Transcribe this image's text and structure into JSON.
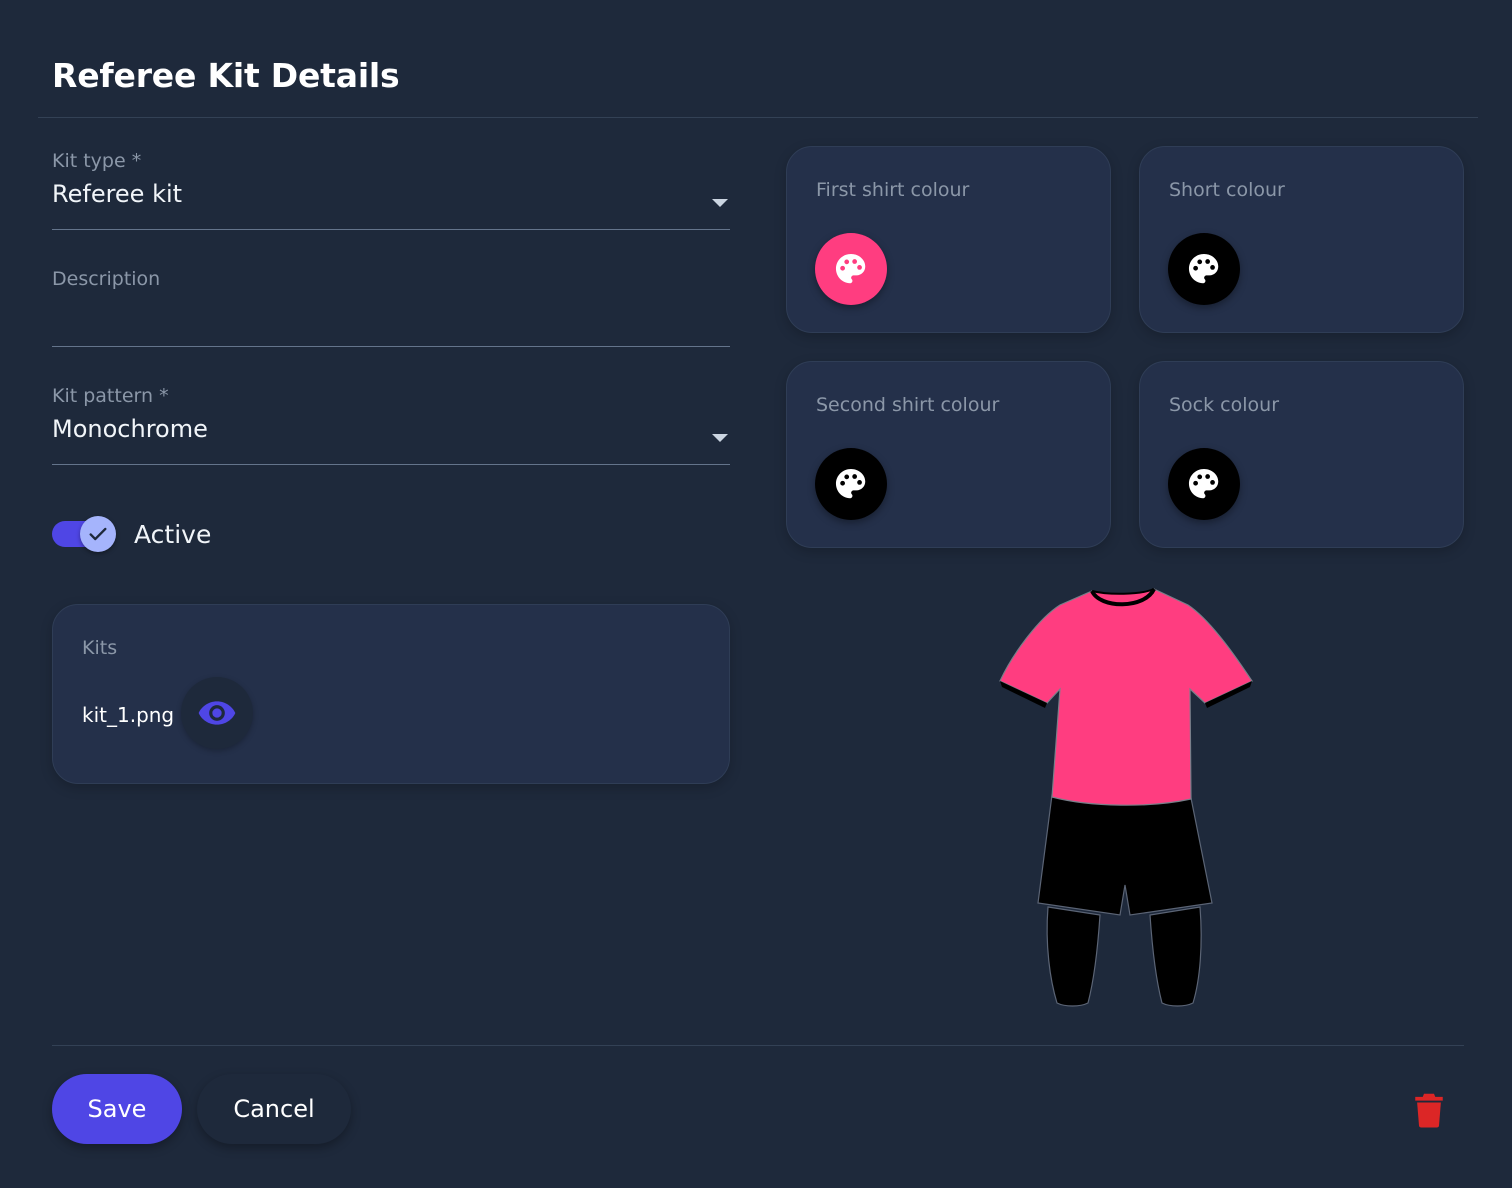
{
  "dialog": {
    "title": "Referee Kit Details"
  },
  "form": {
    "kit_type": {
      "label": "Kit type *",
      "value": "Referee kit"
    },
    "description": {
      "label": "Description",
      "value": ""
    },
    "kit_pattern": {
      "label": "Kit pattern *",
      "value": "Monochrome"
    },
    "active": {
      "label": "Active",
      "checked": true
    }
  },
  "kits": {
    "label": "Kits",
    "file_name": "kit_1.png",
    "view_icon": "eye-icon"
  },
  "colours": {
    "first_shirt": {
      "label": "First shirt colour",
      "color": "#ff3d80",
      "icon": "palette-icon"
    },
    "short": {
      "label": "Short colour",
      "color": "#000000",
      "icon": "palette-icon"
    },
    "second_shirt": {
      "label": "Second shirt colour",
      "color": "#000000",
      "icon": "palette-icon"
    },
    "sock": {
      "label": "Sock colour",
      "color": "#000000",
      "icon": "palette-icon"
    }
  },
  "footer": {
    "save_label": "Save",
    "cancel_label": "Cancel",
    "delete_icon": "trash-icon",
    "delete_color": "#dc2626"
  },
  "theme": {
    "accent": "#4f46e5",
    "background": "#1e293b",
    "card": "#24304a"
  }
}
